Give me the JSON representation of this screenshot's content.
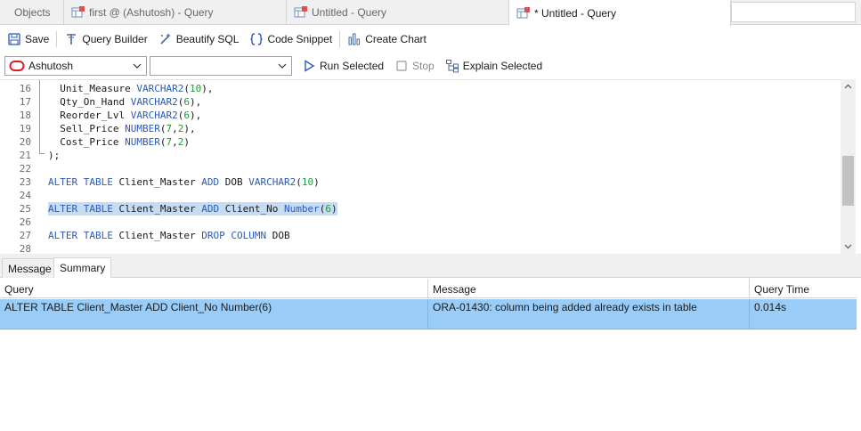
{
  "tabs": [
    {
      "label": "Objects",
      "icon": "none"
    },
    {
      "label": "first @ (Ashutosh) - Query",
      "icon": "query-table-icon"
    },
    {
      "label": "Untitled - Query",
      "icon": "query-table-icon"
    },
    {
      "label": "* Untitled - Query",
      "icon": "query-table-icon"
    }
  ],
  "toolbar": {
    "save": "Save",
    "query_builder": "Query Builder",
    "beautify": "Beautify SQL",
    "snippet": "Code Snippet",
    "chart": "Create Chart"
  },
  "connection": {
    "selected": "Ashutosh",
    "schema": "",
    "brand_color": "#e0182d"
  },
  "actions": {
    "run": "Run Selected",
    "stop": "Stop",
    "explain": "Explain Selected"
  },
  "editor": {
    "lines": [
      {
        "n": "16",
        "code": "  Unit_Measure VARCHAR2(10),"
      },
      {
        "n": "17",
        "code": "  Qty_On_Hand VARCHAR2(6),"
      },
      {
        "n": "18",
        "code": "  Reorder_Lvl VARCHAR2(6),"
      },
      {
        "n": "19",
        "code": "  Sell_Price NUMBER(7,2),"
      },
      {
        "n": "20",
        "code": "  Cost_Price NUMBER(7,2)"
      },
      {
        "n": "21",
        "code": ");"
      },
      {
        "n": "22",
        "code": ""
      },
      {
        "n": "23",
        "code": "ALTER TABLE Client_Master ADD DOB VARCHAR2(10)"
      },
      {
        "n": "24",
        "code": ""
      },
      {
        "n": "25",
        "code": "ALTER TABLE Client_Master ADD Client_No Number(6)"
      },
      {
        "n": "26",
        "code": ""
      },
      {
        "n": "27",
        "code": "ALTER TABLE Client_Master DROP COLUMN DOB"
      },
      {
        "n": "28",
        "code": ""
      }
    ],
    "selected_line": "25"
  },
  "bottom_tabs": [
    "Message",
    "Summary"
  ],
  "results": {
    "headers": [
      "Query",
      "Message",
      "Query Time"
    ],
    "rows": [
      [
        "ALTER TABLE Client_Master ADD Client_No Number(6)",
        "ORA-01430: column being added already exists in table",
        "0.014s"
      ]
    ]
  }
}
